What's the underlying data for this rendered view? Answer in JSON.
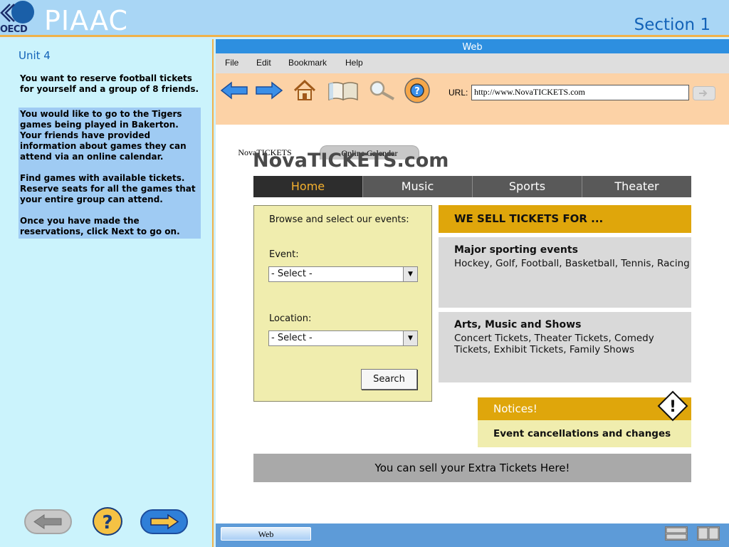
{
  "header": {
    "logo_text": "OECD",
    "app_title": "PIAAC",
    "section": "Section 1"
  },
  "left_panel": {
    "unit": "Unit 4",
    "intro": "You want to reserve football tickets for yourself and a group of 8 friends.",
    "task_paragraphs": [
      "You would like to go to the Tigers games being played in Bakerton. Your friends have provided information about games they can attend via an online calendar.",
      "Find games with available tickets. Reserve seats for all the games that your entire group can attend.",
      "Once you have made the reservations, click Next to go on."
    ]
  },
  "browser": {
    "title": "Web",
    "menu": [
      "File",
      "Edit",
      "Bookmark",
      "Help"
    ],
    "url_label": "URL:",
    "url": "http://www.NovaTICKETS.com",
    "tabs": [
      "NovaTICKETS",
      "Online Calendar"
    ],
    "taskbar_label": "Web"
  },
  "site": {
    "title": "NovaTICKETS.com",
    "nav": [
      "Home",
      "Music",
      "Sports",
      "Theater"
    ],
    "active_nav": "Home",
    "browse_label": "Browse and select our events:",
    "event_label": "Event:",
    "event_value": "- Select -",
    "location_label": "Location:",
    "location_value": "- Select -",
    "search_button": "Search",
    "sell_header": "WE SELL TICKETS FOR ...",
    "info": [
      {
        "title": "Major sporting events",
        "text": "Hockey, Golf, Football, Basketball, Tennis, Racing"
      },
      {
        "title": "Arts, Music and Shows",
        "text": "Concert Tickets, Theater Tickets, Comedy Tickets, Exhibit Tickets, Family Shows"
      }
    ],
    "notices_header": "Notices!",
    "notices_text": "Event cancellations and changes",
    "extra_banner": "You can sell your Extra Tickets Here!"
  },
  "colors": {
    "accent_orange": "#dfa60b",
    "nav_dark": "#595959",
    "nav_active_text": "#f5b12e",
    "browser_title": "#2d8fe0"
  }
}
